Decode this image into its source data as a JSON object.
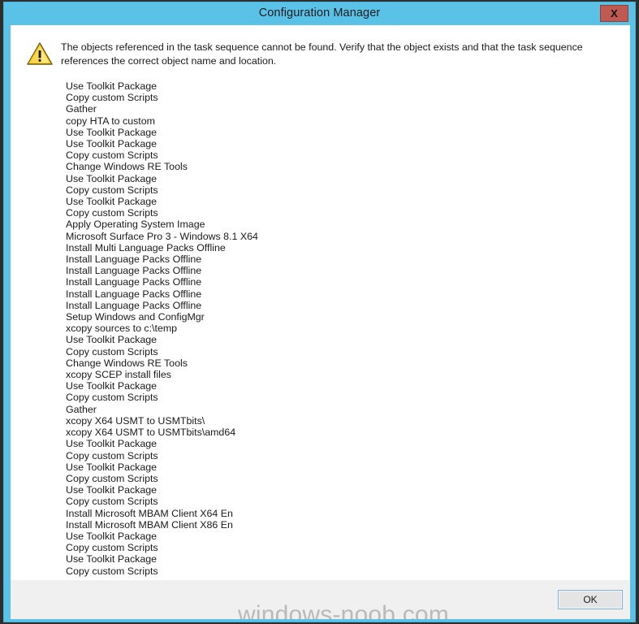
{
  "window": {
    "title": "Configuration Manager",
    "close_label": "X",
    "title_bar_color": "#5bc2e7",
    "close_button_color": "#bf5a52",
    "client_background": "#ffffff",
    "footer_background": "#f0f0f0"
  },
  "message": {
    "icon": "warning-triangle-icon",
    "text": "The objects referenced in the task sequence cannot be found. Verify that the object exists and that the task sequence references the correct object name and location."
  },
  "objects": [
    "Use Toolkit Package",
    "Copy custom Scripts",
    "Gather",
    "copy HTA to custom",
    "Use Toolkit Package",
    "Use Toolkit Package",
    "Copy custom Scripts",
    "Change Windows RE Tools",
    "Use Toolkit Package",
    "Copy custom Scripts",
    "Use Toolkit Package",
    "Copy custom Scripts",
    "Apply Operating System Image",
    "Microsoft Surface Pro 3 - Windows 8.1 X64",
    "Install Multi Language Packs Offline",
    "Install Language Packs Offline",
    "Install Language Packs Offline",
    "Install Language Packs Offline",
    "Install Language Packs Offline",
    "Install Language Packs Offline",
    "Setup Windows and ConfigMgr",
    "xcopy sources to c:\\temp",
    "Use Toolkit Package",
    "Copy custom Scripts",
    "Change Windows RE Tools",
    "xcopy SCEP install files",
    "Use Toolkit Package",
    "Copy custom Scripts",
    "Gather",
    "xcopy X64 USMT to USMTbits\\",
    "xcopy X64 USMT to USMTbits\\amd64",
    "Use Toolkit Package",
    "Copy custom Scripts",
    "Use Toolkit Package",
    "Copy custom Scripts",
    "Use Toolkit Package",
    "Copy custom Scripts",
    "Install Microsoft MBAM Client X64 En",
    "Install Microsoft MBAM Client X86 En",
    "Use Toolkit Package",
    "Copy custom Scripts",
    "Use Toolkit Package",
    "Copy custom Scripts"
  ],
  "footer": {
    "ok_label": "OK",
    "watermark": "windows-noob.com"
  }
}
